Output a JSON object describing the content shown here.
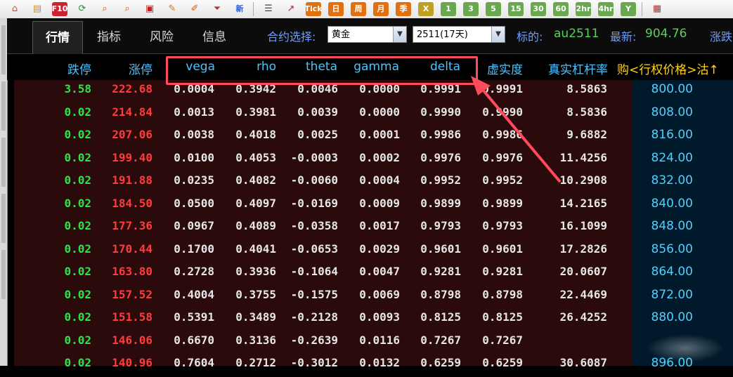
{
  "toolbar": {
    "items": [
      {
        "icon": "home-icon",
        "glyph": "⌂",
        "text": ""
      },
      {
        "icon": "book-icon",
        "glyph": "▤",
        "text": ""
      },
      {
        "icon": "f10-icon",
        "glyph": "",
        "text": "F10"
      },
      {
        "icon": "refresh-icon",
        "glyph": "⟳",
        "text": ""
      },
      {
        "icon": "search-icon",
        "glyph": "⌕",
        "text": ""
      },
      {
        "icon": "search2-icon",
        "glyph": "⌕",
        "text": ""
      },
      {
        "icon": "window-icon",
        "glyph": "▣",
        "text": ""
      },
      {
        "icon": "pen-icon",
        "glyph": "✎",
        "text": ""
      },
      {
        "icon": "brush-icon",
        "glyph": "✐",
        "text": ""
      },
      {
        "icon": "filter-icon",
        "glyph": "⏷",
        "text": ""
      },
      {
        "icon": "new-icon",
        "glyph": "",
        "text": "新"
      },
      {
        "icon": "list-icon",
        "glyph": "☰",
        "text": ""
      },
      {
        "icon": "chart-icon",
        "glyph": "↗",
        "text": ""
      },
      {
        "icon": "tick-icon",
        "glyph": "",
        "text": "Tick"
      },
      {
        "icon": "day-icon",
        "glyph": "",
        "text": "日"
      },
      {
        "icon": "week-icon",
        "glyph": "",
        "text": "周"
      },
      {
        "icon": "month-icon",
        "glyph": "",
        "text": "月"
      },
      {
        "icon": "quarter-icon",
        "glyph": "",
        "text": "季"
      },
      {
        "icon": "x-icon",
        "glyph": "",
        "text": "X"
      },
      {
        "icon": "min1-icon",
        "glyph": "",
        "text": "1"
      },
      {
        "icon": "min3-icon",
        "glyph": "",
        "text": "3"
      },
      {
        "icon": "min5-icon",
        "glyph": "",
        "text": "5"
      },
      {
        "icon": "min15-icon",
        "glyph": "",
        "text": "15"
      },
      {
        "icon": "min30-icon",
        "glyph": "",
        "text": "30"
      },
      {
        "icon": "min60-icon",
        "glyph": "",
        "text": "60"
      },
      {
        "icon": "hr2-icon",
        "glyph": "",
        "text": "2hr"
      },
      {
        "icon": "hr4-icon",
        "glyph": "",
        "text": "4hr"
      },
      {
        "icon": "year-icon",
        "glyph": "",
        "text": "Y"
      },
      {
        "icon": "grid-icon",
        "glyph": "▦",
        "text": ""
      }
    ]
  },
  "tabs": [
    "行情",
    "指标",
    "风险",
    "信息"
  ],
  "contract_select": {
    "label": "合约选择:",
    "value": "黄金"
  },
  "expiry_select": {
    "value": "2511(17天)"
  },
  "underlying": {
    "label": "标的:",
    "value": "au2511"
  },
  "latest": {
    "label": "最新:",
    "value": "904.76"
  },
  "cut_label": "涨跌",
  "columns": [
    "跌停",
    "涨停",
    "vega",
    "rho",
    "theta",
    "gamma",
    "delta",
    "虚实度",
    "真实杠杆率",
    "购<行权价格>沽↑"
  ],
  "rows": [
    {
      "limit_down": "3.58",
      "limit_up": "222.68",
      "vega": "0.0004",
      "rho": "0.3942",
      "theta": "0.0046",
      "gamma": "0.0000",
      "delta": "0.9991",
      "moneyness": "0.9991",
      "leverage": "8.5863",
      "strike": "800.00"
    },
    {
      "limit_down": "0.02",
      "limit_up": "214.84",
      "vega": "0.0013",
      "rho": "0.3981",
      "theta": "0.0039",
      "gamma": "0.0000",
      "delta": "0.9990",
      "moneyness": "0.9990",
      "leverage": "8.5836",
      "strike": "808.00"
    },
    {
      "limit_down": "0.02",
      "limit_up": "207.06",
      "vega": "0.0038",
      "rho": "0.4018",
      "theta": "0.0025",
      "gamma": "0.0001",
      "delta": "0.9986",
      "moneyness": "0.9986",
      "leverage": "9.6882",
      "strike": "816.00"
    },
    {
      "limit_down": "0.02",
      "limit_up": "199.40",
      "vega": "0.0100",
      "rho": "0.4053",
      "theta": "-0.0003",
      "gamma": "0.0002",
      "delta": "0.9976",
      "moneyness": "0.9976",
      "leverage": "11.4256",
      "strike": "824.00"
    },
    {
      "limit_down": "0.02",
      "limit_up": "191.88",
      "vega": "0.0235",
      "rho": "0.4082",
      "theta": "-0.0060",
      "gamma": "0.0004",
      "delta": "0.9952",
      "moneyness": "0.9952",
      "leverage": "10.2908",
      "strike": "832.00"
    },
    {
      "limit_down": "0.02",
      "limit_up": "184.50",
      "vega": "0.0500",
      "rho": "0.4097",
      "theta": "-0.0169",
      "gamma": "0.0009",
      "delta": "0.9899",
      "moneyness": "0.9899",
      "leverage": "14.2165",
      "strike": "840.00"
    },
    {
      "limit_down": "0.02",
      "limit_up": "177.36",
      "vega": "0.0967",
      "rho": "0.4089",
      "theta": "-0.0358",
      "gamma": "0.0017",
      "delta": "0.9793",
      "moneyness": "0.9793",
      "leverage": "16.1099",
      "strike": "848.00"
    },
    {
      "limit_down": "0.02",
      "limit_up": "170.44",
      "vega": "0.1700",
      "rho": "0.4041",
      "theta": "-0.0653",
      "gamma": "0.0029",
      "delta": "0.9601",
      "moneyness": "0.9601",
      "leverage": "17.2826",
      "strike": "856.00"
    },
    {
      "limit_down": "0.02",
      "limit_up": "163.80",
      "vega": "0.2728",
      "rho": "0.3936",
      "theta": "-0.1064",
      "gamma": "0.0047",
      "delta": "0.9281",
      "moneyness": "0.9281",
      "leverage": "20.0607",
      "strike": "864.00"
    },
    {
      "limit_down": "0.02",
      "limit_up": "157.52",
      "vega": "0.4004",
      "rho": "0.3755",
      "theta": "-0.1575",
      "gamma": "0.0069",
      "delta": "0.8798",
      "moneyness": "0.8798",
      "leverage": "22.4469",
      "strike": "872.00"
    },
    {
      "limit_down": "0.02",
      "limit_up": "151.58",
      "vega": "0.5391",
      "rho": "0.3489",
      "theta": "-0.2128",
      "gamma": "0.0093",
      "delta": "0.8125",
      "moneyness": "0.8125",
      "leverage": "26.4252",
      "strike": "880.00"
    },
    {
      "limit_down": "0.02",
      "limit_up": "146.06",
      "vega": "0.6670",
      "rho": "0.3136",
      "theta": "-0.2639",
      "gamma": "0.0116",
      "delta": "0.7267",
      "moneyness": "0.7267",
      "leverage": "",
      "strike": ""
    },
    {
      "limit_down": "0.02",
      "limit_up": "140.96",
      "vega": "0.7604",
      "rho": "0.2712",
      "theta": "-0.3012",
      "gamma": "0.0132",
      "delta": "0.6259",
      "moneyness": "0.6259",
      "leverage": "30.6087",
      "strike": "896.00"
    }
  ],
  "colors": {
    "up": "#ff3b3b",
    "down": "#2fe04a",
    "header": "#4cc3ff",
    "highlight": "#ff4b5c"
  }
}
